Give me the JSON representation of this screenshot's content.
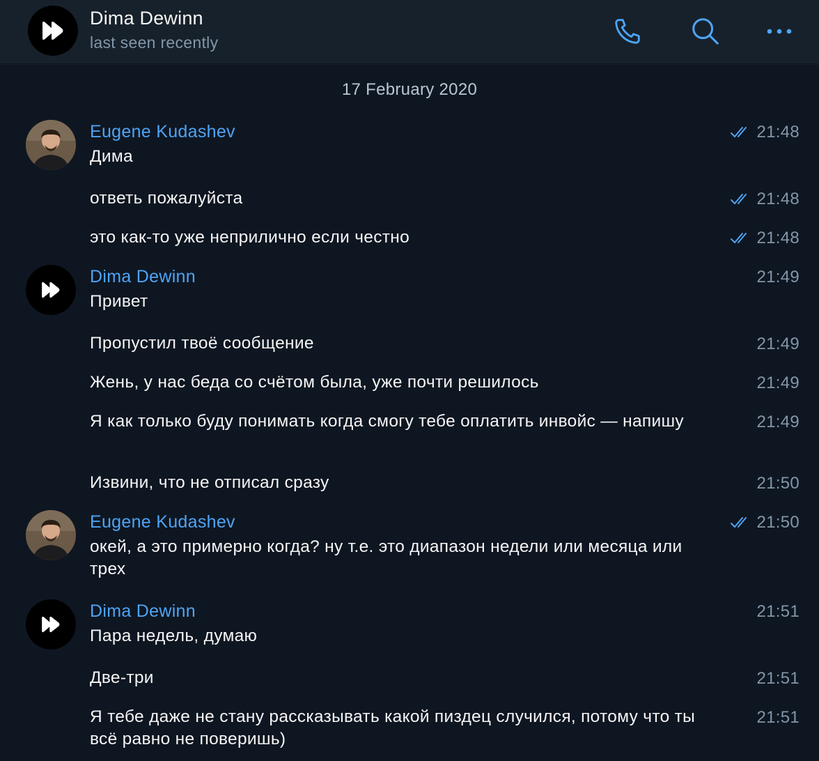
{
  "header": {
    "title": "Dima Dewinn",
    "status": "last seen recently",
    "icons": [
      "phone-icon",
      "search-icon",
      "more-icon"
    ]
  },
  "colors": {
    "accent": "#4ea4f6",
    "background": "#0e1621",
    "header_bg": "#17212b",
    "muted": "#8296a8"
  },
  "chat": {
    "date": "17 February 2020",
    "messages": [
      {
        "sender": "Eugene Kudashev",
        "text": "Дима",
        "time": "21:48",
        "read": true
      },
      {
        "text": "ответь пожалуйста",
        "time": "21:48",
        "read": true
      },
      {
        "text": "это как-то уже неприлично если честно",
        "time": "21:48",
        "read": true
      },
      {
        "sender": "Dima Dewinn",
        "text": "Привет",
        "time": "21:49"
      },
      {
        "text": "Пропустил твоё сообщение",
        "time": "21:49"
      },
      {
        "text": "Жень, у нас беда со счётом была, уже почти решилось",
        "time": "21:49"
      },
      {
        "text": "Я как только буду понимать когда смогу тебе оплатить инвойс — напишу",
        "time": "21:49"
      },
      {
        "text": "Извини, что не отписал сразу",
        "time": "21:50"
      },
      {
        "sender": "Eugene Kudashev",
        "text": "окей, а это примерно когда? ну т.е. это диапазон недели или месяца или трех",
        "time": "21:50",
        "read": true
      },
      {
        "sender": "Dima Dewinn",
        "text": "Пара недель, думаю",
        "time": "21:51"
      },
      {
        "text": "Две-три",
        "time": "21:51"
      },
      {
        "text": "Я тебе даже не стану рассказывать какой пиздец случился, потому что ты всё равно не поверишь)",
        "time": "21:51"
      }
    ]
  }
}
